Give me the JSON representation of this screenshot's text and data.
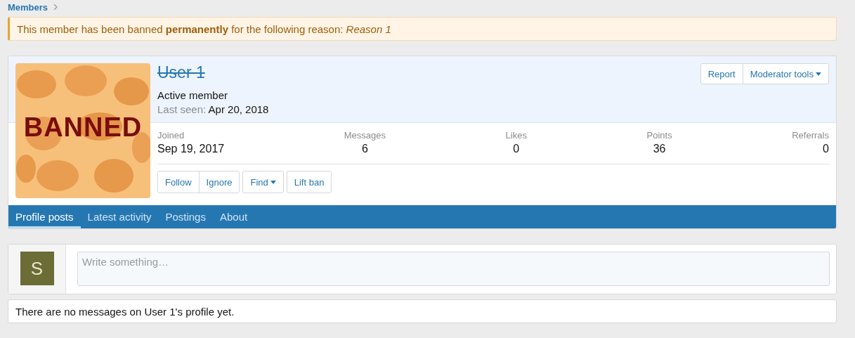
{
  "breadcrumb": {
    "items": [
      "Members"
    ]
  },
  "notice": {
    "text": "This member has been banned **permanently** for the following reason: *Reason 1*"
  },
  "profile": {
    "avatar": {
      "kind": "picture",
      "overlay": "BANNED"
    },
    "name": "User 1",
    "banned": true,
    "title": "Active member",
    "last_seen_label": "Last seen:",
    "last_seen": "Apr 20, 2018",
    "header_buttons": [
      {
        "label": "Report",
        "dropdown": false
      },
      {
        "label": "Moderator tools",
        "dropdown": true
      }
    ],
    "stats": [
      {
        "label": "Joined",
        "value": "Sep 19, 2017"
      },
      {
        "label": "Messages",
        "value": "6"
      },
      {
        "label": "Likes",
        "value": "0"
      },
      {
        "label": "Points",
        "value": "36"
      },
      {
        "label": "Referrals",
        "value": "0"
      }
    ],
    "action_groups": [
      [
        {
          "label": "Follow",
          "dropdown": false
        },
        {
          "label": "Ignore",
          "dropdown": false
        }
      ],
      [
        {
          "label": "Find",
          "dropdown": true
        }
      ],
      [
        {
          "label": "Lift ban",
          "dropdown": false
        }
      ]
    ],
    "tabs": [
      {
        "label": "Profile posts",
        "selected": true
      },
      {
        "label": "Latest activity",
        "selected": false
      },
      {
        "label": "Postings",
        "selected": false
      },
      {
        "label": "About",
        "selected": false
      }
    ]
  },
  "composer": {
    "avatar_letter": "S",
    "placeholder": "Write something…"
  },
  "empty_message": "There are no messages on User 1's profile yet."
}
